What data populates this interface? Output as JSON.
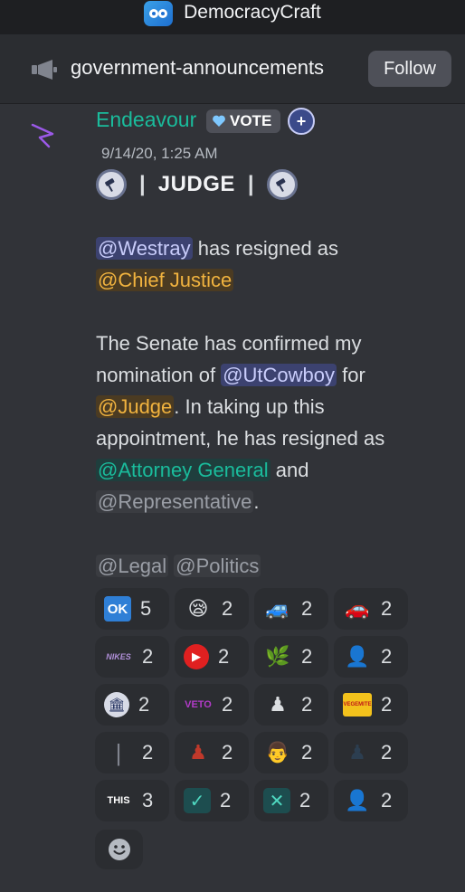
{
  "server": {
    "name": "DemocracyCraft",
    "icon": "server-logo-icon"
  },
  "channel": {
    "name": "government-announcements",
    "icon": "megaphone-icon",
    "follow_label": "Follow"
  },
  "message": {
    "author": "Endeavour",
    "vote_badge": "VOTE",
    "plus_badge": "+",
    "timestamp": "9/14/20, 1:25 AM",
    "role_line": {
      "separator": "|",
      "title": "JUDGE"
    },
    "p1": {
      "m1": "@Westray",
      "t1": " has resigned as ",
      "m2": "@Chief Justice"
    },
    "p2": {
      "t1": "The Senate has confirmed my nomination of ",
      "m1": "@UtCowboy",
      "t2": " for ",
      "m2": "@Judge",
      "t3": ". In taking up this appointment, he has resigned as ",
      "m3": "@Attorney General",
      "t4": " and ",
      "m4": "@Representative",
      "t5": "."
    },
    "p3": {
      "m1": "@Legal",
      "m2": "@Politics"
    }
  },
  "reactions": [
    {
      "emoji": "ok-button",
      "glyph": "OK",
      "count": "5"
    },
    {
      "emoji": "sleepy-face",
      "glyph": "😪",
      "count": "2"
    },
    {
      "emoji": "blue-car",
      "glyph": "🚙",
      "count": "2"
    },
    {
      "emoji": "red-car",
      "glyph": "🚗",
      "count": "2"
    },
    {
      "emoji": "nikes",
      "glyph": "NIKES",
      "count": "2"
    },
    {
      "emoji": "youtube",
      "glyph": "▶",
      "count": "2"
    },
    {
      "emoji": "leaf-sprig",
      "glyph": "🌿",
      "count": "2"
    },
    {
      "emoji": "person-portrait",
      "glyph": "👤",
      "count": "2"
    },
    {
      "emoji": "government-seal",
      "glyph": "🏛",
      "count": "2"
    },
    {
      "emoji": "veto",
      "glyph": "VETO",
      "count": "2"
    },
    {
      "emoji": "pixel-figure",
      "glyph": "♟",
      "count": "2"
    },
    {
      "emoji": "vegemite",
      "glyph": "VEGEMITE",
      "count": "2"
    },
    {
      "emoji": "divider-bar",
      "glyph": "|",
      "count": "2"
    },
    {
      "emoji": "pixel-figure-red",
      "glyph": "♟",
      "count": "2"
    },
    {
      "emoji": "bald-man",
      "glyph": "👨",
      "count": "2"
    },
    {
      "emoji": "pixel-figure-suit",
      "glyph": "♟",
      "count": "2"
    },
    {
      "emoji": "this-arrow",
      "glyph": "THIS",
      "count": "3"
    },
    {
      "emoji": "check-mark",
      "glyph": "✓",
      "count": "2"
    },
    {
      "emoji": "cross-mark",
      "glyph": "✕",
      "count": "2"
    },
    {
      "emoji": "man-portrait",
      "glyph": "👤",
      "count": "2"
    }
  ],
  "add_reaction_icon": "smiley-add-icon"
}
